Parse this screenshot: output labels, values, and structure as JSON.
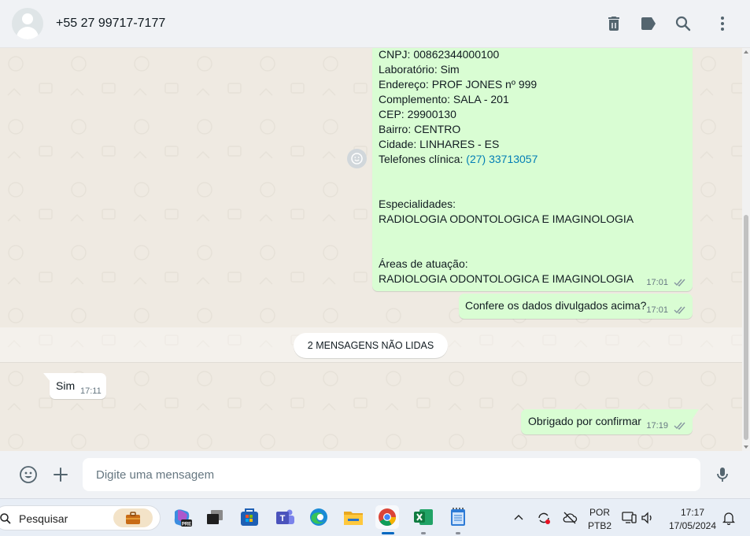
{
  "header": {
    "contact_name": "+55 27 99717-7177",
    "icons": [
      "delete-icon",
      "label-icon",
      "search-icon",
      "menu-icon"
    ]
  },
  "messages": {
    "details": {
      "cnpj": "CNPJ: 00862344000100",
      "laboratorio": "Laboratório: Sim",
      "endereco": "Endereço: PROF JONES nº 999",
      "complemento": "Complemento: SALA - 201",
      "cep": "CEP: 29900130",
      "bairro": "Bairro: CENTRO",
      "cidade": "Cidade: LINHARES - ES",
      "telefones_label": "Telefones clínica:",
      "telefones_link": "(27) 33713057",
      "especialidades_label": "Especialidades:",
      "especialidades_value": "RADIOLOGIA ODONTOLOGICA E IMAGINOLOGIA",
      "areas_label": "Áreas de atuação:",
      "areas_value": "RADIOLOGIA ODONTOLOGICA E IMAGINOLOGIA",
      "time": "17:01"
    },
    "confirm_question": {
      "text": "Confere os dados divulgados acima?",
      "time": "17:01"
    },
    "unread_label": "2 MENSAGENS NÃO LIDAS",
    "reply_sim": {
      "text": "Sim",
      "time": "17:11"
    },
    "reply_thanks": {
      "text": "Obrigado por confirmar",
      "time": "17:19"
    }
  },
  "composer": {
    "placeholder": "Digite uma mensagem",
    "icons": [
      "emoji-icon",
      "attach-plus-icon",
      "microphone-icon"
    ]
  },
  "taskbar": {
    "search_label": "Pesquisar",
    "apps": [
      "work-briefcase",
      "copilot-pre",
      "task-view",
      "microsoft-store",
      "teams",
      "edge",
      "file-explorer",
      "chrome",
      "excel",
      "notepad"
    ],
    "lang_line1": "POR",
    "lang_line2": "PTB2",
    "time": "17:17",
    "date": "17/05/2024"
  },
  "colors": {
    "outgoing_bubble": "#d9fdd3",
    "incoming_bubble": "#ffffff",
    "chat_bg": "#efeae2",
    "link": "#027eb5",
    "header_bg": "#f0f2f5"
  }
}
